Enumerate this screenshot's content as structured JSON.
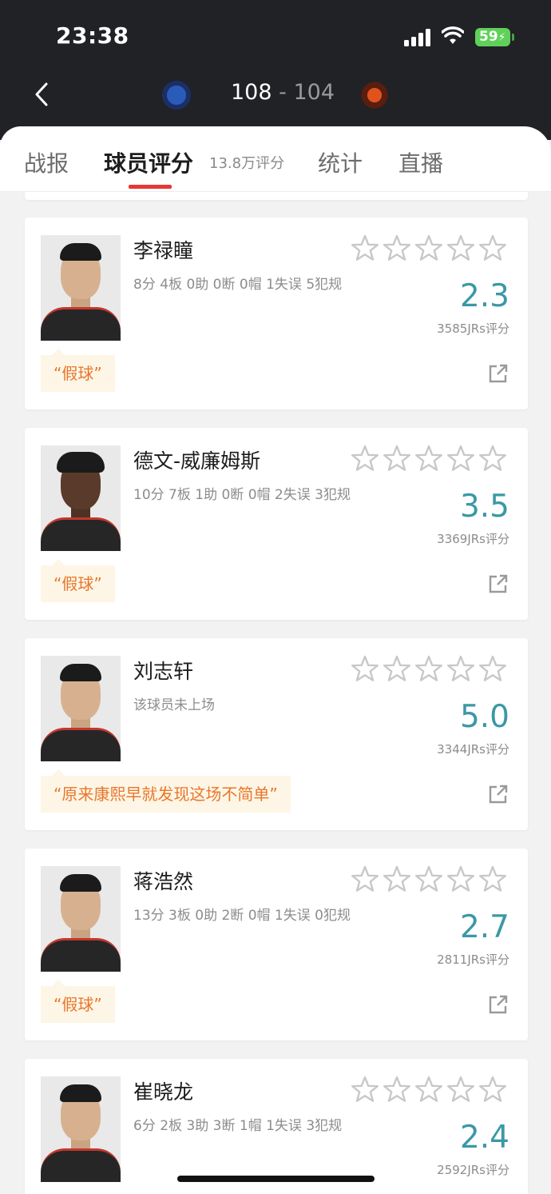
{
  "status_bar": {
    "time": "23:38",
    "battery": "59"
  },
  "game": {
    "home_score": "108",
    "separator": "-",
    "away_score": "104"
  },
  "tabs": [
    {
      "label": "战报"
    },
    {
      "label": "球员评分",
      "sub": "13.8万评分"
    },
    {
      "label": "统计"
    },
    {
      "label": "直播"
    }
  ],
  "colors": {
    "accent_red": "#e53935",
    "rating_teal": "#3b98a5",
    "quote_orange": "#e9762b",
    "header_bg": "#212225"
  },
  "players": [
    {
      "name": "李禄瞳",
      "stats": "8分 4板 0助 0断 0帽 1失误 5犯规",
      "rating": "2.3",
      "votes": "3585JRs评分",
      "quote": "“假球”",
      "stars": 0
    },
    {
      "name": "德文-威廉姆斯",
      "stats": "10分 7板 1助 0断 0帽 2失误 3犯规",
      "rating": "3.5",
      "votes": "3369JRs评分",
      "quote": "“假球”",
      "stars": 0
    },
    {
      "name": "刘志轩",
      "stats": "该球员未上场",
      "rating": "5.0",
      "votes": "3344JRs评分",
      "quote": "“原来康熙早就发现这场不简单”",
      "stars": 0
    },
    {
      "name": "蒋浩然",
      "stats": "13分 3板 0助 2断 0帽 1失误 0犯规",
      "rating": "2.7",
      "votes": "2811JRs评分",
      "quote": "“假球”",
      "stars": 0
    },
    {
      "name": "崔晓龙",
      "stats": "6分 2板 3助 3断 1帽 1失误 3犯规",
      "rating": "2.4",
      "votes": "2592JRs评分",
      "quote": "",
      "stars": 0
    }
  ]
}
